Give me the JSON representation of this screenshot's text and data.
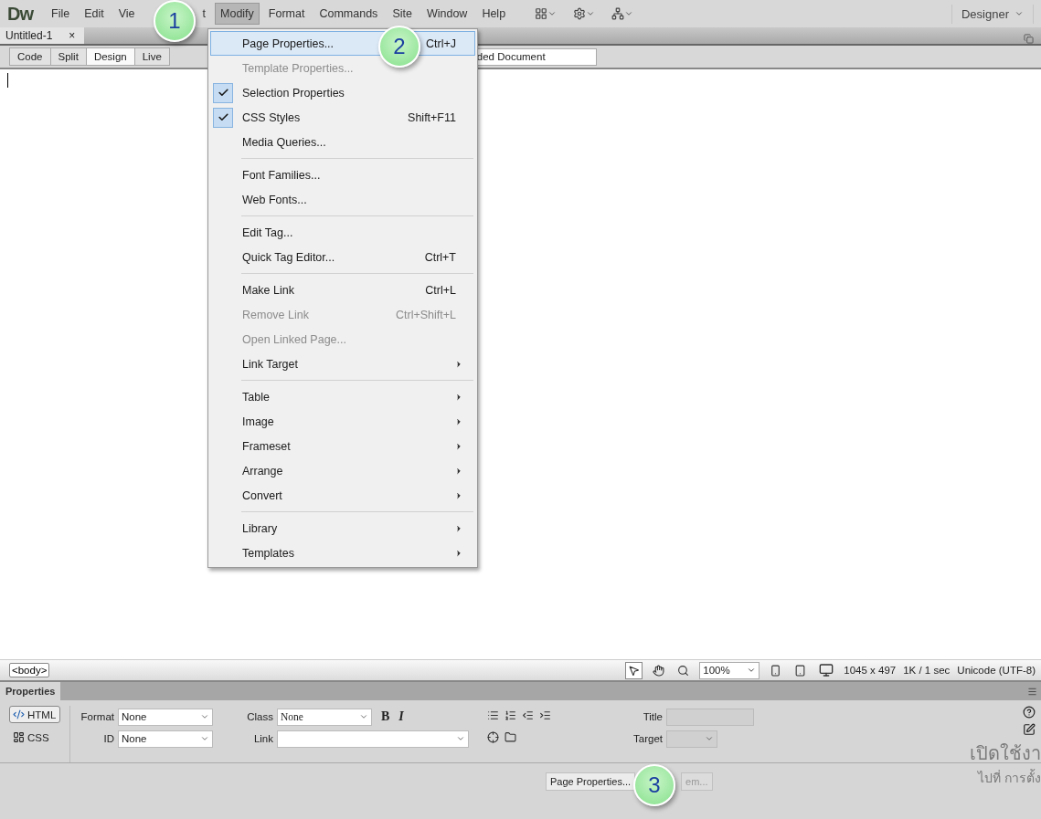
{
  "app": {
    "logo": "Dw",
    "menus": [
      {
        "label": "File",
        "selected": false
      },
      {
        "label": "Edit",
        "selected": false
      },
      {
        "label": "Vie",
        "selected": false
      },
      {
        "label": "t",
        "selected": false
      },
      {
        "label": "Modify",
        "selected": true
      },
      {
        "label": "Format",
        "selected": false
      },
      {
        "label": "Commands",
        "selected": false
      },
      {
        "label": "Site",
        "selected": false
      },
      {
        "label": "Window",
        "selected": false
      },
      {
        "label": "Help",
        "selected": false
      }
    ],
    "workspace": "Designer"
  },
  "document_tab": {
    "title": "Untitled-1",
    "close": "×"
  },
  "view_buttons": [
    {
      "label": "Code",
      "selected": false
    },
    {
      "label": "Split",
      "selected": false
    },
    {
      "label": "Design",
      "selected": true
    },
    {
      "label": "Live",
      "selected": false
    }
  ],
  "title_field": {
    "value": "ded Document"
  },
  "modify_menu": [
    {
      "kind": "item",
      "label": "Page Properties...",
      "shortcut": "Ctrl+J",
      "selected": true,
      "disabled": false,
      "checked": false,
      "submenu": false
    },
    {
      "kind": "item",
      "label": "Template Properties...",
      "selected": false,
      "disabled": true,
      "checked": false,
      "submenu": false
    },
    {
      "kind": "item",
      "label": "Selection Properties",
      "selected": false,
      "disabled": false,
      "checked": true,
      "submenu": false
    },
    {
      "kind": "item",
      "label": "CSS Styles",
      "shortcut": "Shift+F11",
      "selected": false,
      "disabled": false,
      "checked": true,
      "submenu": false
    },
    {
      "kind": "item",
      "label": "Media Queries...",
      "selected": false,
      "disabled": false,
      "checked": false,
      "submenu": false
    },
    {
      "kind": "separator"
    },
    {
      "kind": "item",
      "label": "Font Families...",
      "selected": false,
      "disabled": false,
      "checked": false,
      "submenu": false
    },
    {
      "kind": "item",
      "label": "Web Fonts...",
      "selected": false,
      "disabled": false,
      "checked": false,
      "submenu": false
    },
    {
      "kind": "separator"
    },
    {
      "kind": "item",
      "label": "Edit Tag...",
      "selected": false,
      "disabled": false,
      "checked": false,
      "submenu": false
    },
    {
      "kind": "item",
      "label": "Quick Tag Editor...",
      "shortcut": "Ctrl+T",
      "selected": false,
      "disabled": false,
      "checked": false,
      "submenu": false
    },
    {
      "kind": "separator"
    },
    {
      "kind": "item",
      "label": "Make Link",
      "shortcut": "Ctrl+L",
      "selected": false,
      "disabled": false,
      "checked": false,
      "submenu": false
    },
    {
      "kind": "item",
      "label": "Remove Link",
      "shortcut": "Ctrl+Shift+L",
      "selected": false,
      "disabled": true,
      "checked": false,
      "submenu": false
    },
    {
      "kind": "item",
      "label": "Open Linked Page...",
      "selected": false,
      "disabled": true,
      "checked": false,
      "submenu": false
    },
    {
      "kind": "item",
      "label": "Link Target",
      "selected": false,
      "disabled": false,
      "checked": false,
      "submenu": true
    },
    {
      "kind": "separator"
    },
    {
      "kind": "item",
      "label": "Table",
      "selected": false,
      "disabled": false,
      "checked": false,
      "submenu": true
    },
    {
      "kind": "item",
      "label": "Image",
      "selected": false,
      "disabled": false,
      "checked": false,
      "submenu": true
    },
    {
      "kind": "item",
      "label": "Frameset",
      "selected": false,
      "disabled": false,
      "checked": false,
      "submenu": true
    },
    {
      "kind": "item",
      "label": "Arrange",
      "selected": false,
      "disabled": false,
      "checked": false,
      "submenu": true
    },
    {
      "kind": "item",
      "label": "Convert",
      "selected": false,
      "disabled": false,
      "checked": false,
      "submenu": true
    },
    {
      "kind": "separator"
    },
    {
      "kind": "item",
      "label": "Library",
      "selected": false,
      "disabled": false,
      "checked": false,
      "submenu": true
    },
    {
      "kind": "item",
      "label": "Templates",
      "selected": false,
      "disabled": false,
      "checked": false,
      "submenu": true
    }
  ],
  "step_markers": [
    "1",
    "2",
    "3"
  ],
  "status_bar": {
    "tag": "<body>",
    "zoom": "100%",
    "window_size": "1045 x 497",
    "download": "1K / 1 sec",
    "encoding": "Unicode (UTF-8)"
  },
  "properties": {
    "title": "Properties",
    "modes": [
      {
        "label": "HTML",
        "selected": true
      },
      {
        "label": "CSS",
        "selected": false
      }
    ],
    "format_label": "Format",
    "format_value": "None",
    "id_label": "ID",
    "id_value": "None",
    "class_label": "Class",
    "class_value": "None",
    "bold": "B",
    "italic": "I",
    "link_label": "Link",
    "title_label": "Title",
    "target_label": "Target",
    "page_properties_button": "Page Properties...",
    "list_item_button": "em..."
  },
  "os_notice": [
    "เปิดใช้งา",
    "ไปที่ การตั้ง"
  ]
}
